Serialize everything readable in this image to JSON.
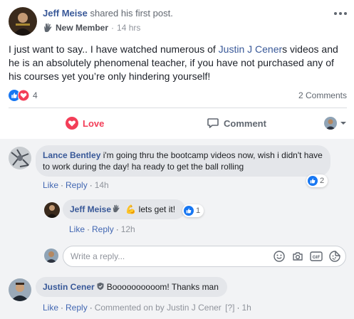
{
  "post": {
    "author": "Jeff Meise",
    "shared_text": "shared his first post.",
    "badge": "New Member",
    "time": "14 hrs",
    "body_prefix": "I just want to say.. I have watched numerous of ",
    "body_mention": "Justin J Cener",
    "body_suffix": "s videos and he is an absolutely phenomenal teacher, if you have not purchased any of his courses yet you’re only hindering yourself!",
    "reaction_count": "4",
    "comment_count": "2 Comments"
  },
  "actions": {
    "love": "Love",
    "comment": "Comment"
  },
  "comments": [
    {
      "name": "Lance Bentley",
      "text": "i'm going thru the bootcamp videos now, wish i didn't have to work during the day! ha ready to get the ball rolling",
      "like": "Like",
      "reply": "Reply",
      "time": "14h",
      "reactions": "2"
    },
    {
      "name": "Jeff Meise",
      "emoji": "💪",
      "text": "lets get it!",
      "like": "Like",
      "reply": "Reply",
      "time": "12h",
      "reactions": "1"
    },
    {
      "name": "Justin Cener",
      "text": "Boooooooooom! Thanks man",
      "like": "Like",
      "reply": "Reply",
      "commented_on": "Commented on by Justin J Cener",
      "help": "[?]",
      "time": "1h"
    }
  ],
  "reply_box": {
    "placeholder": "Write a reply..."
  },
  "colors": {
    "link": "#385898",
    "love": "#f33e58",
    "like_blue": "#1877f2",
    "bubble": "#e4e6ea",
    "comment_area": "#f2f3f5"
  }
}
